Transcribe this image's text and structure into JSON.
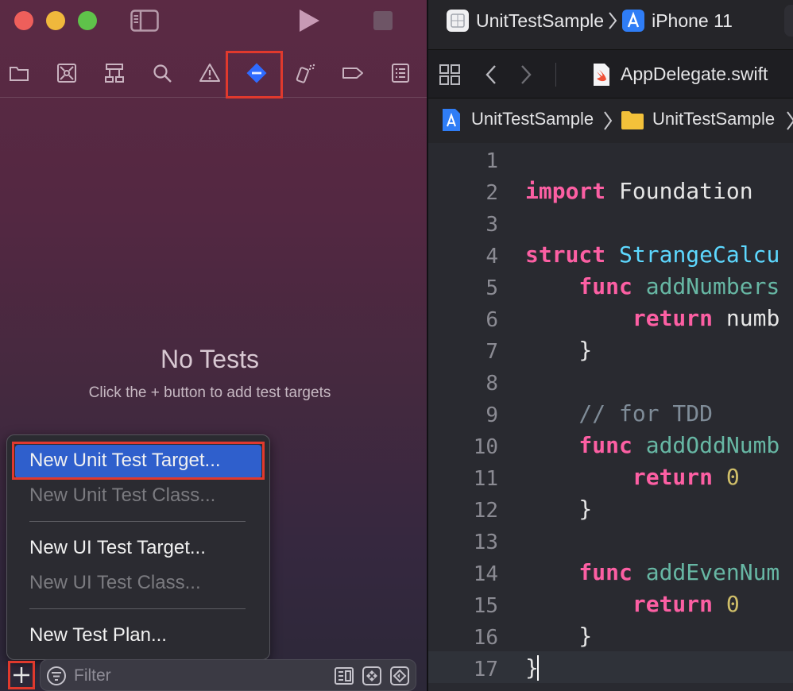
{
  "window": {
    "scheme": "UnitTestSample",
    "destination": "iPhone 11"
  },
  "navigator": {
    "tabs": [
      "folder-icon",
      "source-control-icon",
      "hierarchy-icon",
      "search-icon",
      "warning-icon",
      "test-navigator-icon",
      "debug-icon",
      "breakpoint-icon",
      "report-icon"
    ],
    "active_tab": "test-navigator-icon",
    "empty_title": "No Tests",
    "empty_subtitle": "Click the + button to add test targets"
  },
  "menu": {
    "items": [
      {
        "label": "New Unit Test Target...",
        "enabled": true,
        "highlighted": true
      },
      {
        "label": "New Unit Test Class...",
        "enabled": false
      },
      {
        "label": "New UI Test Target...",
        "enabled": true
      },
      {
        "label": "New UI Test Class...",
        "enabled": false
      },
      {
        "label": "New Test Plan...",
        "enabled": true
      }
    ]
  },
  "filter": {
    "placeholder": "Filter"
  },
  "editor": {
    "file_tab": "AppDelegate.swift",
    "jump_bar": [
      "UnitTestSample",
      "UnitTestSample"
    ],
    "line_numbers": [
      "1",
      "2",
      "3",
      "4",
      "5",
      "6",
      "7",
      "8",
      "9",
      "10",
      "11",
      "12",
      "13",
      "14",
      "15",
      "16",
      "17"
    ],
    "code": {
      "l2_kw": "import",
      "l2_rest": " Foundation",
      "l4_kw": "struct",
      "l4_type": " StrangeCalcu",
      "l5_kw": "    func",
      "l5_fn": " addNumbers",
      "l6_kw": "        return",
      "l6_rest": " numb",
      "l7": "    }",
      "l9": "    // for TDD",
      "l10_kw": "    func",
      "l10_fn": " addOddNumb",
      "l11_kw": "        return",
      "l11_num": " 0",
      "l12": "    }",
      "l14_kw": "    func",
      "l14_fn": " addEvenNum",
      "l15_kw": "        return",
      "l15_num": " 0",
      "l16": "    }",
      "l17": "}"
    }
  },
  "colors": {
    "highlight_box": "#e0392d",
    "menu_selection": "#2f5fcc",
    "keyword": "#fc5fa3",
    "type": "#5dd8ff",
    "function": "#67b7a4"
  }
}
